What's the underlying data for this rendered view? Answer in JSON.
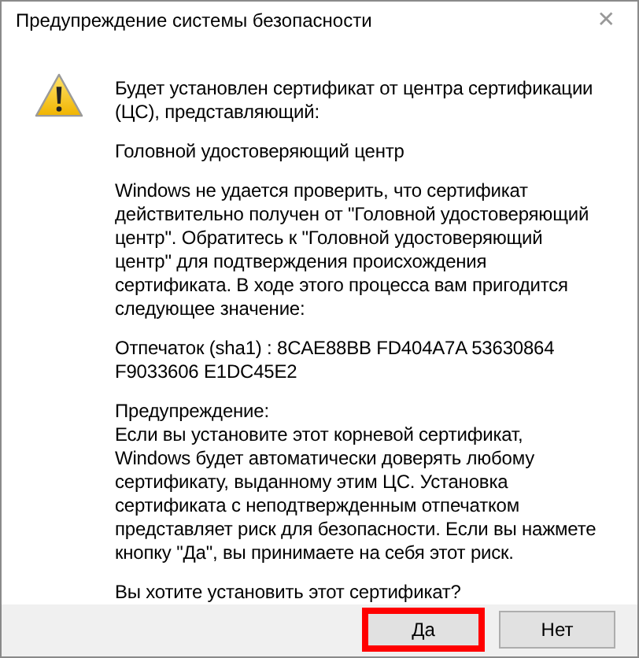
{
  "window": {
    "title": "Предупреждение системы безопасности",
    "close": "✕"
  },
  "paragraphs": [
    "Будет установлен сертификат от центра сертификации (ЦС), представляющий:",
    "Головной удостоверяющий центр",
    "Windows не удается проверить, что сертификат действительно получен от \"Головной удостоверяющий центр\". Обратитесь к \"Головной удостоверяющий центр\" для подтверждения происхождения сертификата. В ходе этого процесса вам пригодится следующее значение:",
    "Отпечаток (sha1) : 8CAE88BB FD404A7A 53630864 F9033606 E1DC45E2",
    "Предупреждение:\nЕсли вы установите этот корневой сертификат, Windows будет автоматически доверять любому сертификату, выданному этим ЦС. Установка сертификата с неподтвержденным отпечатком представляет риск для безопасности. Если вы нажмете кнопку \"Да\", вы принимаете на себя этот риск.",
    "Вы хотите установить этот сертификат?"
  ],
  "buttons": [
    {
      "label": "Да",
      "highlighted": true
    },
    {
      "label": "Нет",
      "highlighted": false
    }
  ]
}
